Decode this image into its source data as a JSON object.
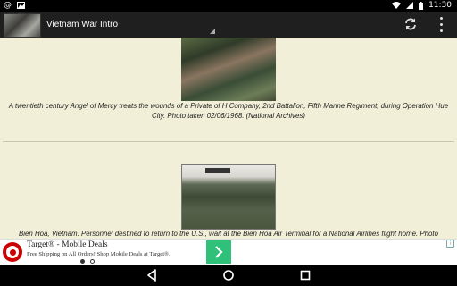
{
  "status_bar": {
    "time": "11:30",
    "icons": [
      "at-sign-icon",
      "image-icon",
      "wifi-icon",
      "signal-icon",
      "battery-icon"
    ]
  },
  "action_bar": {
    "title": "Vietnam War Intro",
    "actions": [
      "refresh-icon",
      "overflow-menu-icon"
    ]
  },
  "content": {
    "items": [
      {
        "caption": "A twentieth century Angel of Mercy treats the wounds of a Private of H Company, 2nd Battalion, Fifth Marine Regiment, during Operation Hue City. Photo taken 02/06/1968. (National Archives)"
      },
      {
        "caption": "Bien Hoa, Vietnam. Personnel destined to return to the U.S., wait at the Bien Hoa Air Terminal for a National Airlines flight home. Photo"
      }
    ]
  },
  "ad": {
    "title": "Target® - Mobile Deals",
    "subtitle": "Free Shipping on All Orders! Shop Mobile Deals at Target®.",
    "brand_color": "#cc0000",
    "button_color": "#2fc07a",
    "pages": 2,
    "active_page": 1
  },
  "nav_bar": {
    "buttons": [
      "back-icon",
      "home-icon",
      "recents-icon"
    ]
  }
}
